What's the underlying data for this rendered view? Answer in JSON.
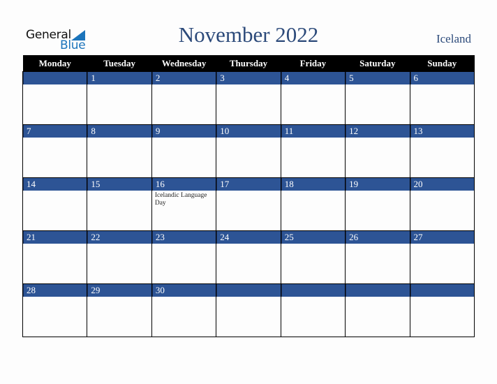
{
  "logo": {
    "line1": "General",
    "line2": "Blue"
  },
  "header": {
    "title": "November 2022",
    "country": "Iceland"
  },
  "weekdays": [
    "Monday",
    "Tuesday",
    "Wednesday",
    "Thursday",
    "Friday",
    "Saturday",
    "Sunday"
  ],
  "weeks": [
    [
      {
        "day": ""
      },
      {
        "day": "1"
      },
      {
        "day": "2"
      },
      {
        "day": "3"
      },
      {
        "day": "4"
      },
      {
        "day": "5"
      },
      {
        "day": "6"
      }
    ],
    [
      {
        "day": "7"
      },
      {
        "day": "8"
      },
      {
        "day": "9"
      },
      {
        "day": "10"
      },
      {
        "day": "11"
      },
      {
        "day": "12"
      },
      {
        "day": "13"
      }
    ],
    [
      {
        "day": "14"
      },
      {
        "day": "15"
      },
      {
        "day": "16",
        "event": "Icelandic Language Day"
      },
      {
        "day": "17"
      },
      {
        "day": "18"
      },
      {
        "day": "19"
      },
      {
        "day": "20"
      }
    ],
    [
      {
        "day": "21"
      },
      {
        "day": "22"
      },
      {
        "day": "23"
      },
      {
        "day": "24"
      },
      {
        "day": "25"
      },
      {
        "day": "26"
      },
      {
        "day": "27"
      }
    ],
    [
      {
        "day": "28"
      },
      {
        "day": "29"
      },
      {
        "day": "30"
      },
      {
        "day": ""
      },
      {
        "day": ""
      },
      {
        "day": ""
      },
      {
        "day": ""
      }
    ]
  ]
}
